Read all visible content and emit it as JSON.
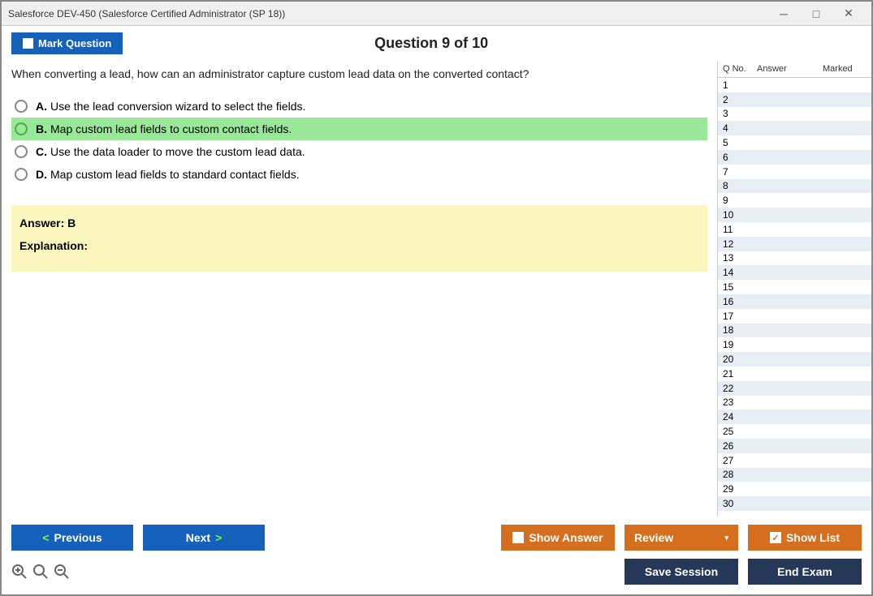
{
  "window": {
    "title": "Salesforce DEV-450 (Salesforce Certified Administrator (SP 18))"
  },
  "header": {
    "mark_label": "Mark Question",
    "question_title": "Question 9 of 10"
  },
  "question": {
    "text": "When converting a lead, how can an administrator capture custom lead data on the converted contact?"
  },
  "options": [
    {
      "letter": "A.",
      "text": "Use the lead conversion wizard to select the fields.",
      "correct": false
    },
    {
      "letter": "B.",
      "text": "Map custom lead fields to custom contact fields.",
      "correct": true
    },
    {
      "letter": "C.",
      "text": "Use the data loader to move the custom lead data.",
      "correct": false
    },
    {
      "letter": "D.",
      "text": "Map custom lead fields to standard contact fields.",
      "correct": false
    }
  ],
  "answer": {
    "line": "Answer: B",
    "explanation_label": "Explanation:"
  },
  "sidebar": {
    "headers": {
      "qno": "Q No.",
      "answer": "Answer",
      "marked": "Marked"
    },
    "rows": [
      1,
      2,
      3,
      4,
      5,
      6,
      7,
      8,
      9,
      10,
      11,
      12,
      13,
      14,
      15,
      16,
      17,
      18,
      19,
      20,
      21,
      22,
      23,
      24,
      25,
      26,
      27,
      28,
      29,
      30
    ]
  },
  "footer": {
    "previous": "Previous",
    "next": "Next",
    "show_answer": "Show Answer",
    "review": "Review",
    "show_list": "Show List",
    "save_session": "Save Session",
    "end_exam": "End Exam"
  }
}
